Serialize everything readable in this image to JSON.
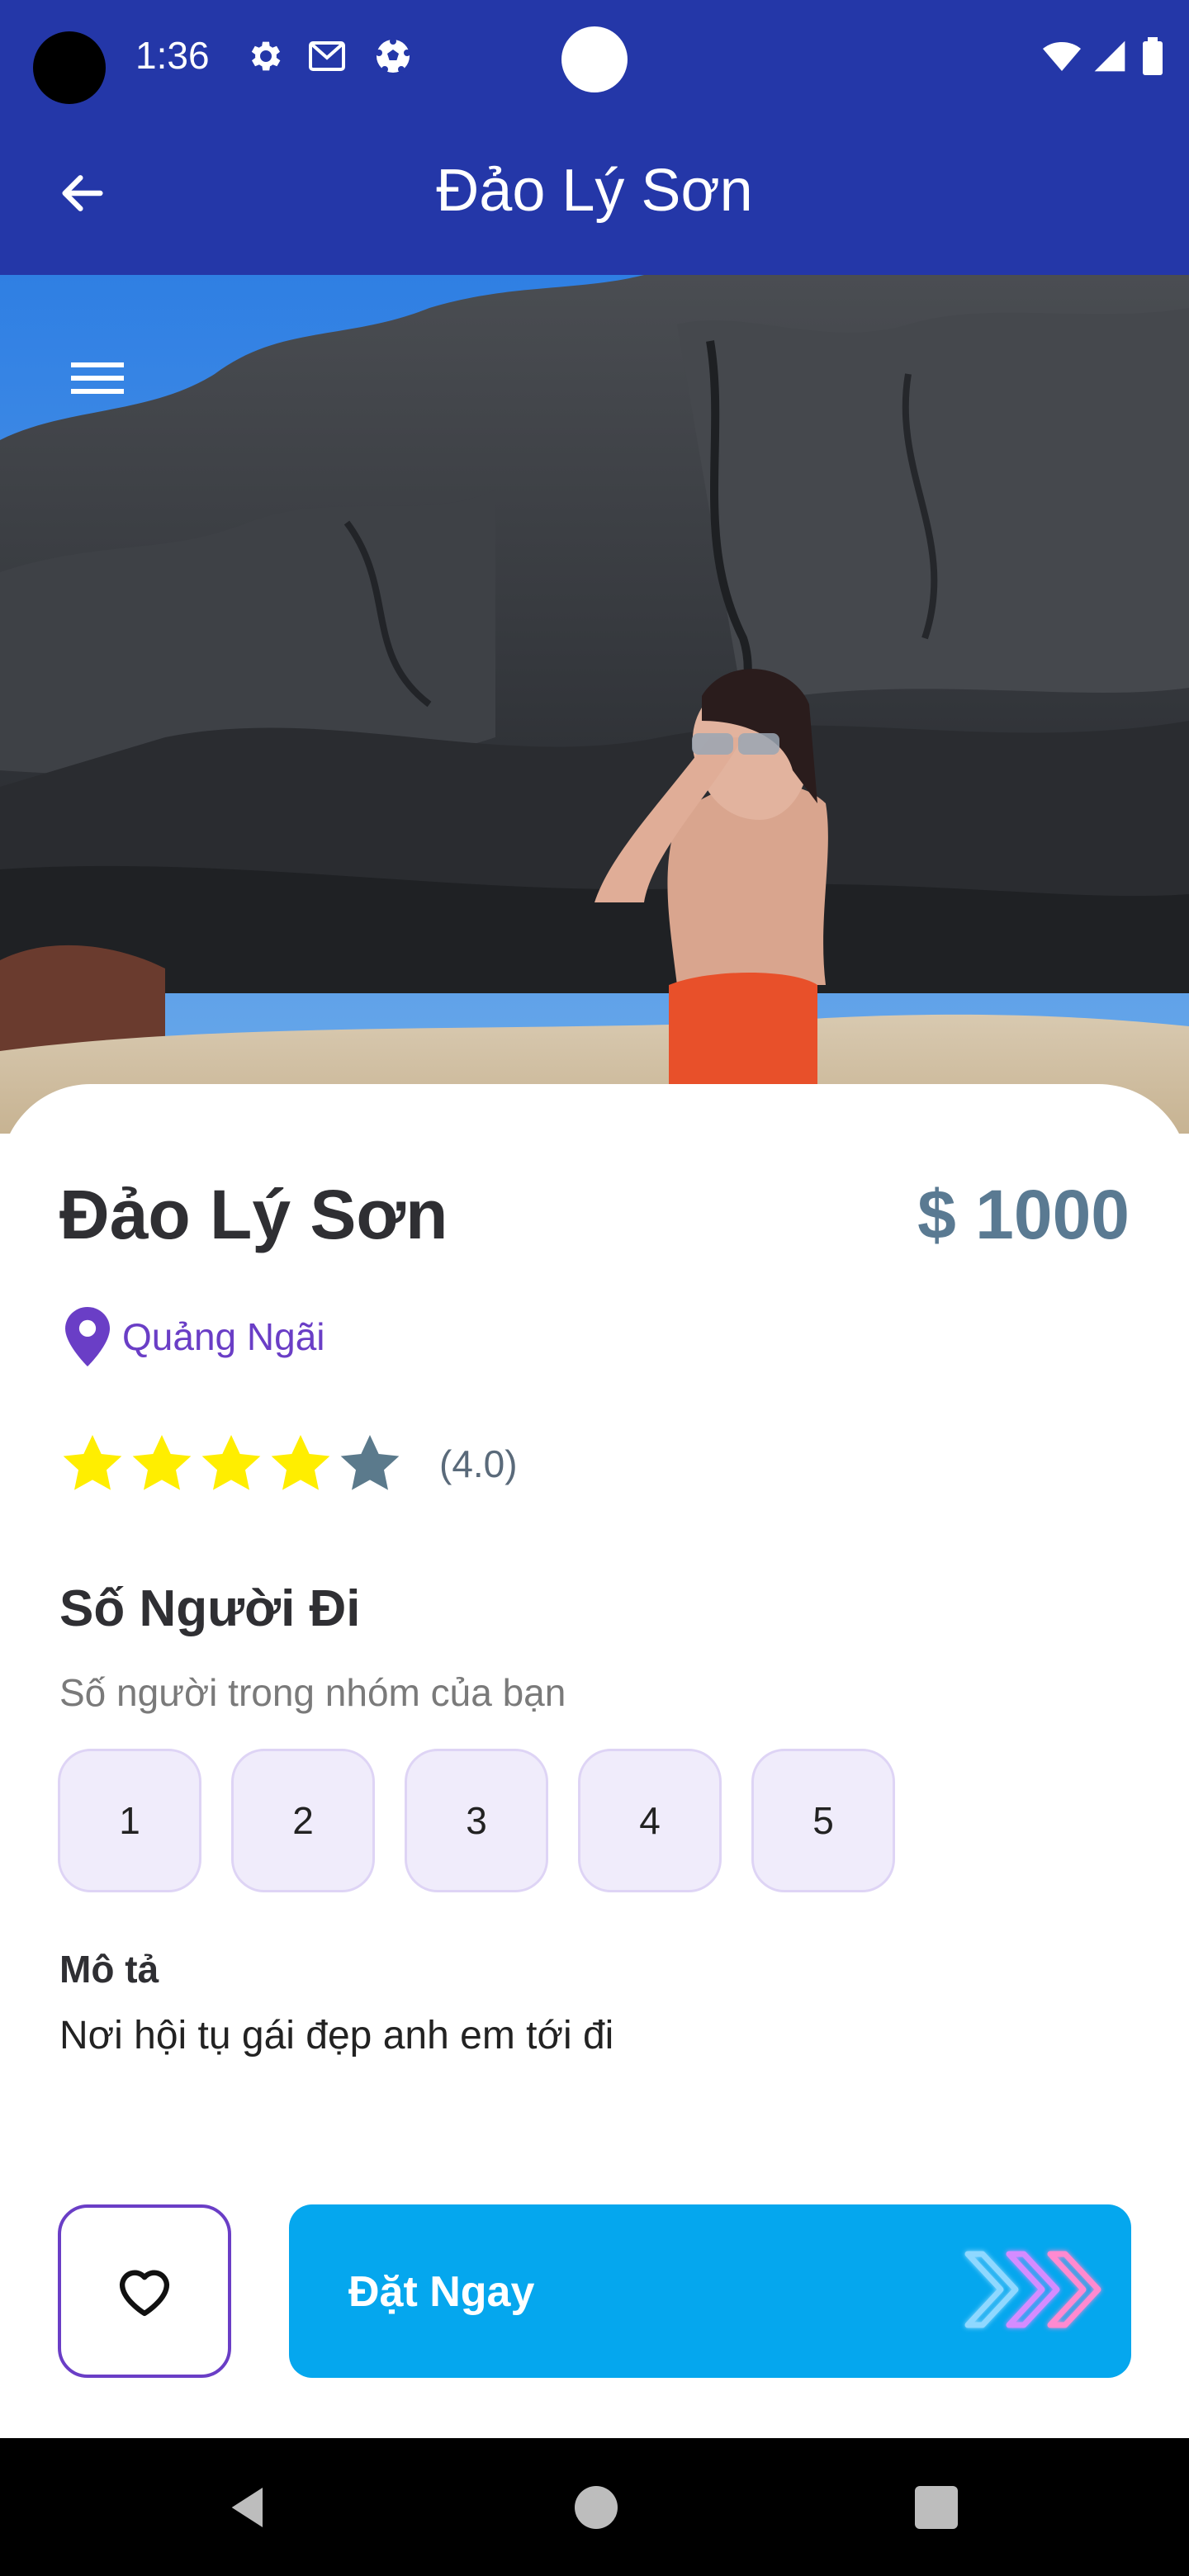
{
  "status_bar": {
    "time": "1:36",
    "icons": [
      "settings-icon",
      "gmail-icon",
      "soccer-ball-icon",
      "wifi-icon",
      "signal-icon",
      "battery-icon"
    ]
  },
  "app_bar": {
    "title": "Đảo Lý Sơn",
    "back_icon": "arrow-left-icon"
  },
  "hero": {
    "menu_icon": "hamburger-menu-icon"
  },
  "place": {
    "name": "Đảo Lý Sơn",
    "price": "$ 1000",
    "location": "Quảng Ngãi",
    "rating": 4,
    "rating_max": 5,
    "rating_text": "(4.0)"
  },
  "group": {
    "title": "Số Người Đi",
    "subtitle": "Số người trong nhóm của bạn",
    "options": [
      "1",
      "2",
      "3",
      "4",
      "5"
    ]
  },
  "description": {
    "label": "Mô tả",
    "text": "Nơi hội tụ gái đẹp anh em tới đi"
  },
  "actions": {
    "book_label": "Đặt Ngay"
  },
  "colors": {
    "app_bar": "#2437a8",
    "accent_purple": "#6a3ec6",
    "book_button": "#05a7ee",
    "star_filled": "#ffee00",
    "star_empty": "#5b7a8c",
    "price": "#5a7a92"
  }
}
